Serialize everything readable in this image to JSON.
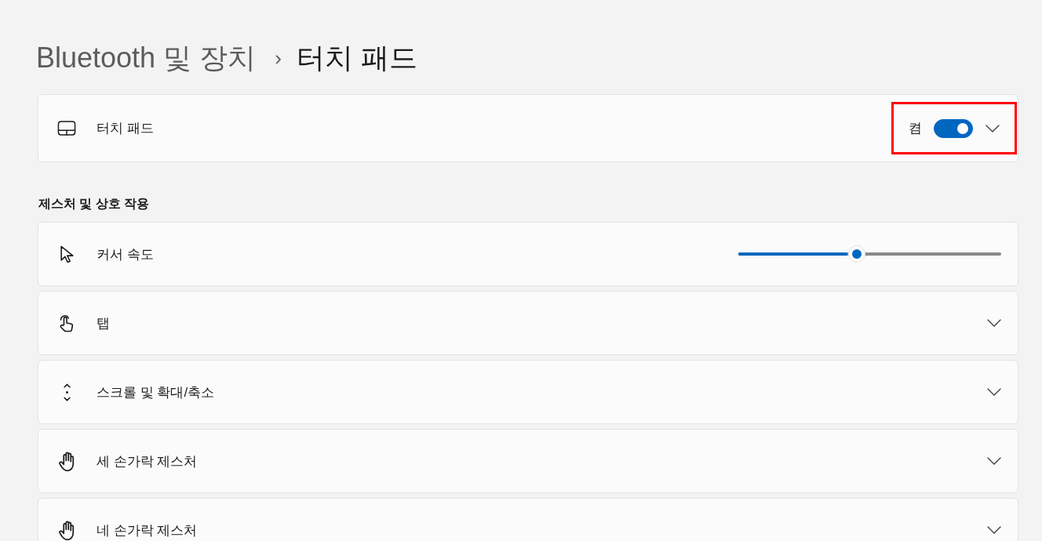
{
  "breadcrumb": {
    "parent": "Bluetooth 및 장치",
    "separator": "›",
    "current": "터치 패드"
  },
  "touchpad": {
    "label": "터치 패드",
    "state_label": "켬",
    "on": true,
    "expanded": false,
    "highlighted": true
  },
  "section_title": "제스처 및 상호 작용",
  "settings": [
    {
      "kind": "slider",
      "label": "커서 속도",
      "level": 0.45
    },
    {
      "kind": "expander",
      "label": "탭",
      "expanded": false
    },
    {
      "kind": "expander",
      "label": "스크롤 및 확대/축소",
      "expanded": false
    },
    {
      "kind": "expander",
      "label": "세 손가락 제스처",
      "expanded": false
    },
    {
      "kind": "expander",
      "label": "네 손가락 제스처",
      "expanded": false
    }
  ]
}
